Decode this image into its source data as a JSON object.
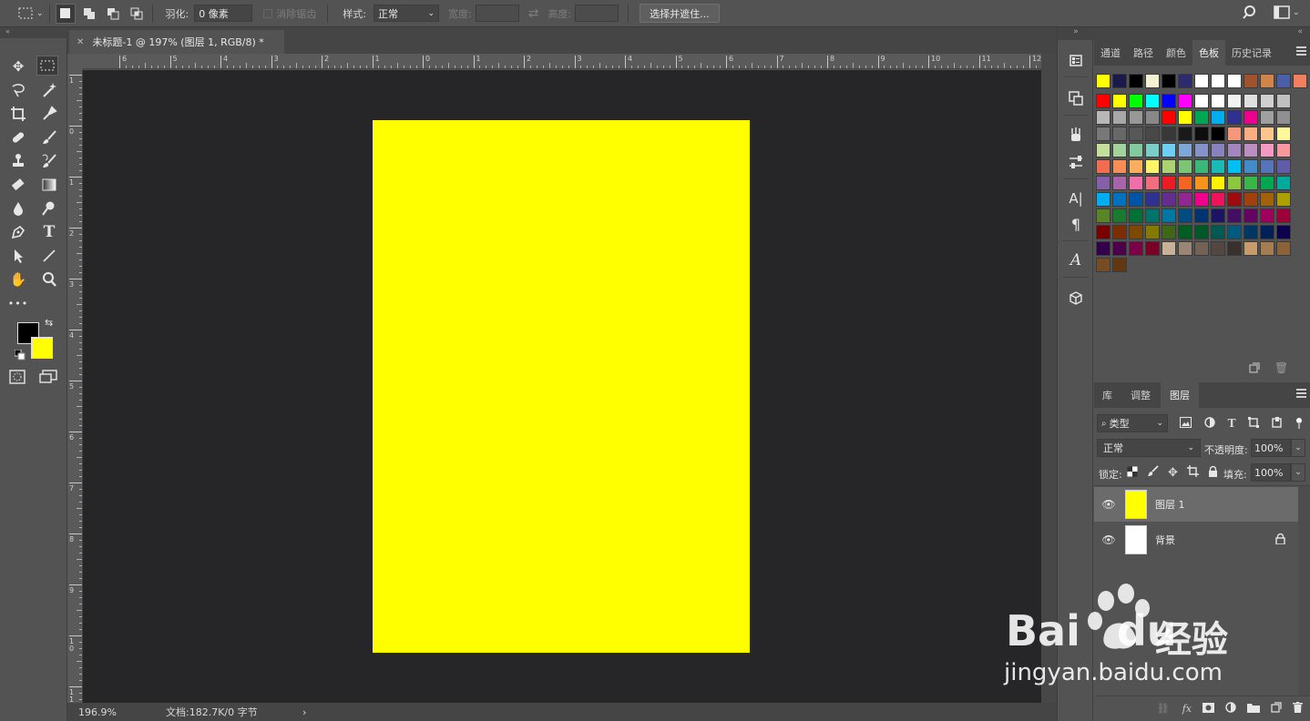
{
  "options_bar": {
    "feather_label": "羽化:",
    "feather_value": "0 像素",
    "antialias_label": "消除锯齿",
    "style_label": "样式:",
    "style_value": "正常",
    "width_label": "宽度:",
    "height_label": "高度:",
    "select_mask_button": "选择并遮住..."
  },
  "document": {
    "tab_title": "未标题-1 @ 197% (图层 1, RGB/8) *",
    "canvas_color": "#ffff00",
    "h_ruler_labels": [
      "6",
      "5",
      "4",
      "3",
      "2",
      "1",
      "0",
      "1",
      "2",
      "3",
      "4",
      "5",
      "6",
      "7",
      "8",
      "9",
      "10",
      "11",
      "12"
    ],
    "v_ruler_labels": [
      "1",
      "0",
      "1",
      "2",
      "3",
      "4",
      "5",
      "6",
      "7",
      "8",
      "9",
      "1 0",
      "1 1"
    ]
  },
  "status_bar": {
    "zoom": "196.9%",
    "doc_info": "文档:182.7K/0 字节",
    "arrow": "›"
  },
  "tools": {
    "foreground_color": "#000000",
    "background_color": "#ffff00",
    "more_label": "•••"
  },
  "swatches_panel": {
    "tabs": [
      "通道",
      "路径",
      "颜色",
      "色板",
      "历史记录"
    ],
    "active_tab": "色板",
    "recent_colors": [
      "#ffff00",
      "#1a1a4a",
      "#000000",
      "#f5f0d0",
      "#000000",
      "#2b2b6e",
      "#ffffff",
      "#ffffff",
      "#ffffff",
      "#a0522d",
      "#d2854a",
      "#4a5fa8",
      "#f08060"
    ],
    "colors": [
      "#ff0000",
      "#ffff00",
      "#00ff00",
      "#00ffff",
      "#0000ff",
      "#ff00ff",
      "#ffffff",
      "#ffffff",
      "#f2f2f2",
      "#e0e0e0",
      "#d0d0d0",
      "#c0c0c0",
      "#b8b8b8",
      "#a8a8a8",
      "#989898",
      "#888888",
      "#ff0000",
      "#ffff00",
      "#00a651",
      "#00aeef",
      "#2e3192",
      "#ec008c",
      "#a0a0a0",
      "#909090",
      "#787878",
      "#686868",
      "#585858",
      "#484848",
      "#383838",
      "#1a1a1a",
      "#0d0d0d",
      "#000000",
      "#f7977a",
      "#fbad82",
      "#fdc68c",
      "#fff79a",
      "#c4df9b",
      "#a3d39c",
      "#82ca9d",
      "#7bcdc8",
      "#6ecff6",
      "#7ea7d8",
      "#8493ca",
      "#8882be",
      "#a187be",
      "#bc8dbf",
      "#f49ac2",
      "#f6989d",
      "#f26c4f",
      "#f68e55",
      "#fbaf5d",
      "#fff467",
      "#acd372",
      "#7cc576",
      "#3bb878",
      "#1abbb4",
      "#00bff3",
      "#438cca",
      "#5574b9",
      "#605ca8",
      "#8560a8",
      "#a864a8",
      "#f06eaa",
      "#f26d7d",
      "#ed1c24",
      "#f26522",
      "#f7941d",
      "#fff200",
      "#8dc73f",
      "#39b54a",
      "#00a651",
      "#00a99d",
      "#00aeef",
      "#0072bc",
      "#0054a6",
      "#2e3192",
      "#662d91",
      "#92278f",
      "#ec008c",
      "#ed145b",
      "#9e0b0f",
      "#a0410d",
      "#a36209",
      "#aba000",
      "#598527",
      "#1a7b30",
      "#007236",
      "#00746b",
      "#0076a3",
      "#004b80",
      "#003471",
      "#1b1464",
      "#440e62",
      "#630460",
      "#9e005d",
      "#9e0039",
      "#790000",
      "#7b2e00",
      "#7d4900",
      "#827b00",
      "#406618",
      "#005e20",
      "#005826",
      "#005952",
      "#005b7f",
      "#003663",
      "#002157",
      "#0d004c",
      "#32004b",
      "#4b0049",
      "#7b0046",
      "#7a0026",
      "#c7b299",
      "#998675",
      "#736357",
      "#534741",
      "#37302d",
      "#c69c6d",
      "#a67c52",
      "#8c6239",
      "#754c24",
      "#603913"
    ]
  },
  "layers_panel": {
    "tabs": [
      "库",
      "调整",
      "图层"
    ],
    "active_tab": "图层",
    "filter_kind": "类型",
    "blend_mode": "正常",
    "opacity_label": "不透明度:",
    "opacity_value": "100%",
    "lock_label": "锁定:",
    "fill_label": "填充:",
    "fill_value": "100%",
    "layers": [
      {
        "name": "图层 1",
        "thumb": "#ffff00",
        "selected": true,
        "locked": false
      },
      {
        "name": "背景",
        "thumb": "#ffffff",
        "selected": false,
        "locked": true
      }
    ]
  },
  "watermark": {
    "brand": "Bai",
    "brand2": "du",
    "cn": "经验",
    "url": "jingyan.baidu.com"
  }
}
